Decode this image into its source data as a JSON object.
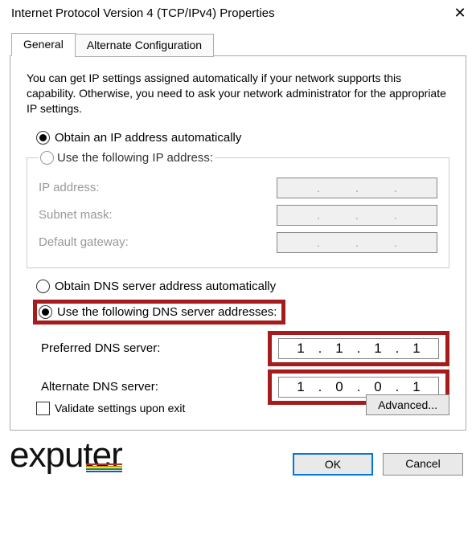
{
  "window": {
    "title": "Internet Protocol Version 4 (TCP/IPv4) Properties"
  },
  "tabs": {
    "general": "General",
    "alternate": "Alternate Configuration"
  },
  "intro": "You can get IP settings assigned automatically if your network supports this capability. Otherwise, you need to ask your network administrator for the appropriate IP settings.",
  "ip": {
    "auto": "Obtain an IP address automatically",
    "manual": "Use the following IP address:",
    "address_label": "IP address:",
    "mask_label": "Subnet mask:",
    "gateway_label": "Default gateway:"
  },
  "dns": {
    "auto": "Obtain DNS server address automatically",
    "manual": "Use the following DNS server addresses:",
    "preferred_label": "Preferred DNS server:",
    "alternate_label": "Alternate DNS server:",
    "preferred": {
      "o1": "1",
      "o2": "1",
      "o3": "1",
      "o4": "1"
    },
    "alternate": {
      "o1": "1",
      "o2": "0",
      "o3": "0",
      "o4": "1"
    }
  },
  "validate": "Validate settings upon exit",
  "buttons": {
    "advanced": "Advanced...",
    "ok": "OK",
    "cancel": "Cancel"
  },
  "logo": {
    "ex": "ex",
    "rest": "puter"
  }
}
